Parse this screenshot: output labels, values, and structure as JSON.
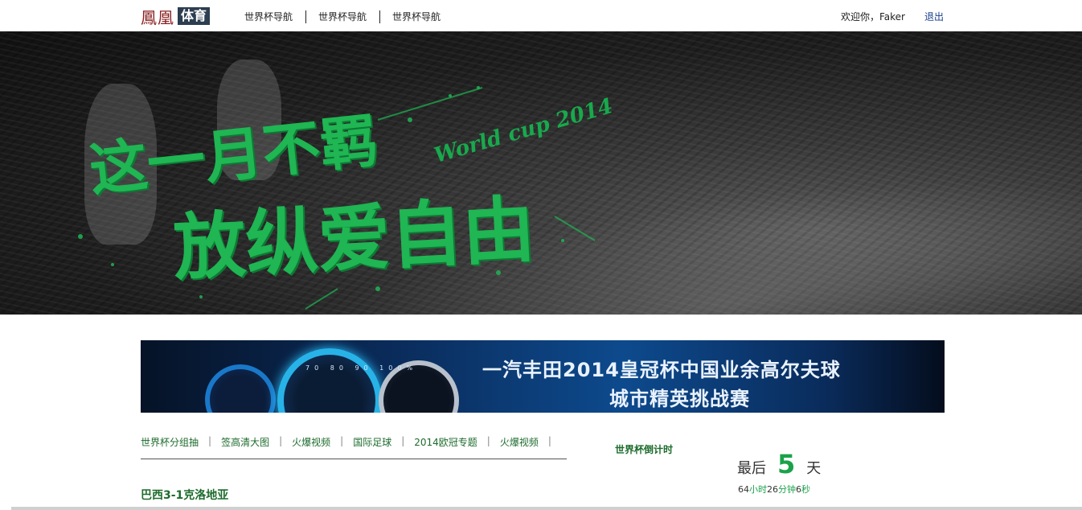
{
  "header": {
    "logo_main": "鳳凰",
    "logo_tag": "体育",
    "nav": [
      "世界杯导航",
      "世界杯导航",
      "世界杯导航"
    ],
    "welcome": "欢迎你，Faker",
    "logout": "退出"
  },
  "hero": {
    "wordmark": "World cup 2014",
    "slogan_line1": "这一月不羁",
    "slogan_line2": "放纵爱自由"
  },
  "ad": {
    "line1": "一汽丰田2014皇冠杯中国业余高尔夫球",
    "line2": "城市精英挑战赛",
    "gauge_ticks": "70 80 90 100%"
  },
  "subnav": {
    "items": [
      "世界杯分组抽",
      "签高清大图",
      "火爆视频",
      "国际足球",
      "2014欧冠专题",
      "火爆视频"
    ],
    "separator": "|"
  },
  "headline": "巴西3-1克洛地亚",
  "countdown": {
    "title": "世界杯倒计时",
    "prefix": "最后",
    "days": "5",
    "days_unit": "天",
    "hours": "64",
    "hours_unit": "小时",
    "minutes": "26",
    "minutes_unit": "分钟",
    "seconds": "6",
    "seconds_unit": "秒"
  },
  "colors": {
    "accent_green": "#1aa24a",
    "link_green": "#1d6b2c",
    "logout_blue": "#1a3f8a"
  }
}
